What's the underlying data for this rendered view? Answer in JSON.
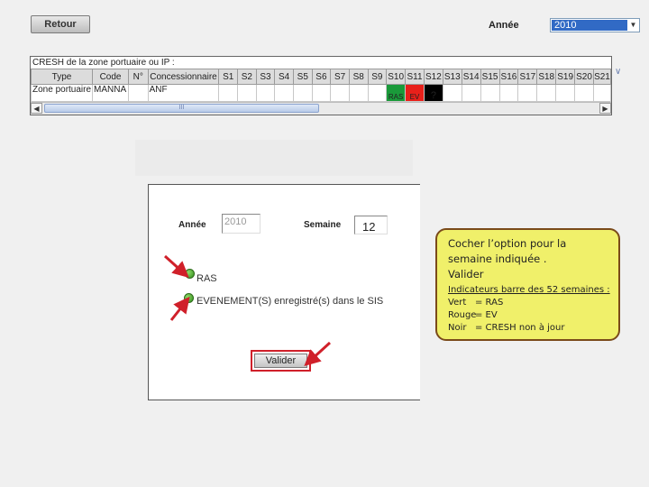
{
  "toolbar": {
    "retour_label": "Retour"
  },
  "year_filter": {
    "label": "Année",
    "value": "2010"
  },
  "cresh": {
    "title": "CRESH de la zone portuaire ou IP :",
    "columns": [
      "Type",
      "Code",
      "N°",
      "Concessionnaire",
      "S1",
      "S2",
      "S3",
      "S4",
      "S5",
      "S6",
      "S7",
      "S8",
      "S9",
      "S10",
      "S11",
      "S12",
      "S13",
      "S14",
      "S15",
      "S16",
      "S17",
      "S18",
      "S19",
      "S20",
      "S21"
    ],
    "row": {
      "type": "Zone portuaire",
      "code": "MANNA",
      "num": "",
      "concessionnaire": "ANF",
      "s10": "RAS",
      "s11": "EV",
      "s12": "?"
    },
    "scroll_thumb_mark": "III"
  },
  "form": {
    "annee_label": "Année",
    "annee_value": "2010",
    "semaine_label": "Semaine",
    "semaine_value": "12",
    "option_ras": "RAS",
    "option_ev": "EVENEMENT(S) enregistré(s) dans le SIS",
    "valider_label": "Valider"
  },
  "callout": {
    "line1": "Cocher l’option  pour la",
    "line2": "semaine indiquée .",
    "line3": "Valider",
    "heading": "Indicateurs barre des 52 semaines :",
    "items": [
      {
        "key": "Vert",
        "value": "= RAS"
      },
      {
        "key": "Rouge",
        "value": "= EV"
      },
      {
        "key": "Noir",
        "value": "=  CRESH non à jour"
      }
    ]
  },
  "colors": {
    "ras": "#1a9a3a",
    "ev": "#e8201a",
    "unknown": "#000000",
    "callout_bg": "#f0f06a",
    "arrow": "#d0202a"
  }
}
